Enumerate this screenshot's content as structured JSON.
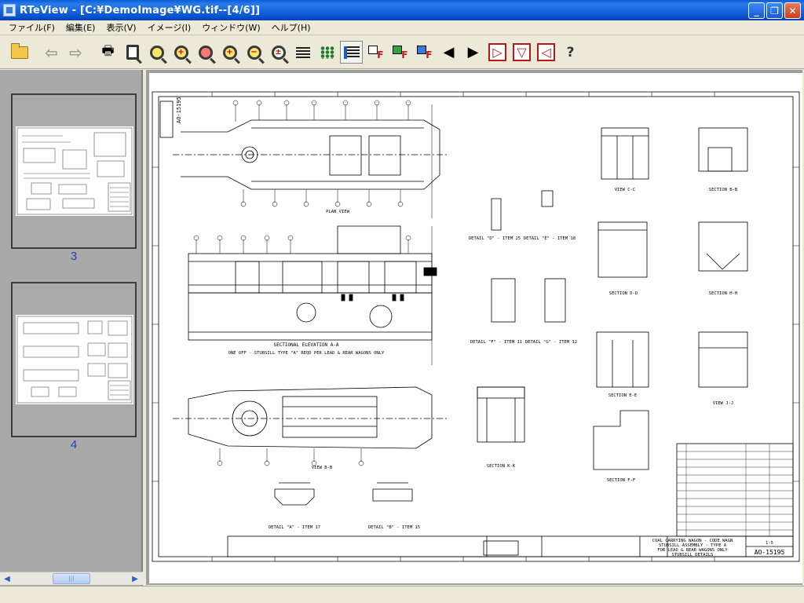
{
  "window": {
    "title": "RTeView - [C:¥DemoImage¥WG.tif--[4/6]]",
    "controls": {
      "minimize": "_",
      "restore": "❐",
      "close": "✕"
    }
  },
  "menu": [
    "ファイル(F)",
    "編集(E)",
    "表示(V)",
    "イメージ(I)",
    "ウィンドウ(W)",
    "ヘルプ(H)"
  ],
  "toolbar": {
    "icons": [
      "open-folder-icon",
      "back-arrow-icon",
      "forward-arrow-icon",
      "print-icon",
      "print-preview-icon",
      "zoom-fit-icon",
      "zoom-in-icon",
      "zoom-red-icon",
      "zoom-plus-icon",
      "zoom-out-icon",
      "zoom-area-icon",
      "text-view-icon",
      "grid-view-icon",
      "list-view-icon",
      "frame-f-icon",
      "frame-f-green-icon",
      "frame-f-color-icon",
      "prev-page-icon",
      "next-page-icon",
      "rotate-right-icon",
      "flip-down-icon",
      "rotate-left-icon",
      "help-icon"
    ],
    "pressed": "list-view-icon"
  },
  "thumbnails": [
    {
      "page": "3",
      "selected": false
    },
    {
      "page": "4",
      "selected": true
    }
  ],
  "thumb_scroll": {
    "thumb_label": "|||"
  },
  "drawing": {
    "number": "AO-15195",
    "views": {
      "plan": "PLAN VIEW",
      "section_cc": "VIEW C-C",
      "section_bb": "SECTION B-B",
      "detail_d": "DETAIL \"D\" - ITEM 25",
      "detail_e": "DETAIL \"E\" - ITEM 18",
      "section_dd": "SECTION D-D",
      "section_hh": "SECTION H-H",
      "elevation": "SECTIONAL ELEVATION A-A",
      "elevation_sub": "ONE OFF - STUBSILL TYPE \"A\" REQD PER LEAD & REAR WAGONS ONLY",
      "detail_f": "DETAIL \"F\" - ITEM 11",
      "detail_g": "DETAIL \"G\" - ITEM 12",
      "section_ee": "SECTION E-E",
      "section_jj": "VIEW J-J",
      "view_bb": "VIEW B-B",
      "section_kk": "SECTION K-K",
      "section_ff": "SECTION F-F",
      "detail_a": "DETAIL \"A\" - ITEM 17",
      "detail_b": "DETAIL \"B\" - ITEM 15"
    },
    "title_block": {
      "line1": "COAL CARRYING WAGON - CODE WAGN",
      "line2": "STUBSILL ASSEMBLY - TYPE A",
      "line3": "FOR LEAD & REAR WAGONS ONLY",
      "line4": "STUBSILL DETAILS",
      "scale": "1:5"
    }
  }
}
